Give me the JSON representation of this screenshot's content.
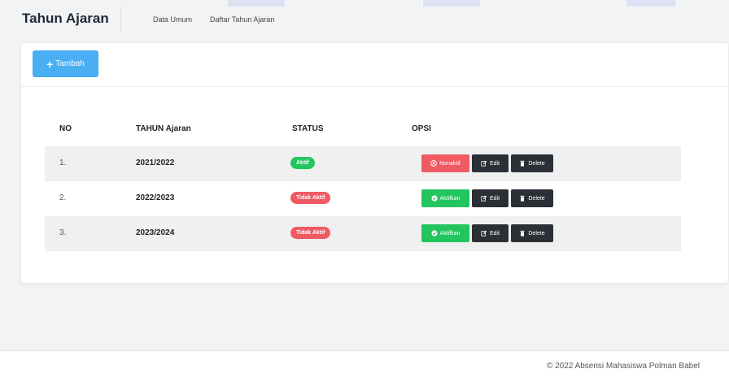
{
  "header": {
    "title": "Tahun Ajaran",
    "crumbs": [
      "Data Umum",
      "Daftar Tahun Ajaran"
    ]
  },
  "toolbar": {
    "add_label": "Tambah"
  },
  "table": {
    "columns": [
      "NO",
      "TAHUN Ajaran",
      "STATUS",
      "OPSI"
    ],
    "rows": [
      {
        "no": "1.",
        "year": "2021/2022",
        "status": "Aktif",
        "toggle": "Nonaktif",
        "edit": "Edit",
        "delete": "Delete"
      },
      {
        "no": "2.",
        "year": "2022/2023",
        "status": "Tidak Aktif",
        "toggle": "Aktifkan",
        "edit": "Edit",
        "delete": "Delete"
      },
      {
        "no": "3.",
        "year": "2023/2024",
        "status": "Tidak Aktif",
        "toggle": "Aktifkan",
        "edit": "Edit",
        "delete": "Delete"
      }
    ]
  },
  "footer": {
    "text": "© 2022 Absensi Mahasiswa Polman Babel"
  },
  "colors": {
    "primary": "#4aaef2",
    "success": "#22c55e",
    "danger": "#ef5a63",
    "dark": "#2b2f36"
  }
}
